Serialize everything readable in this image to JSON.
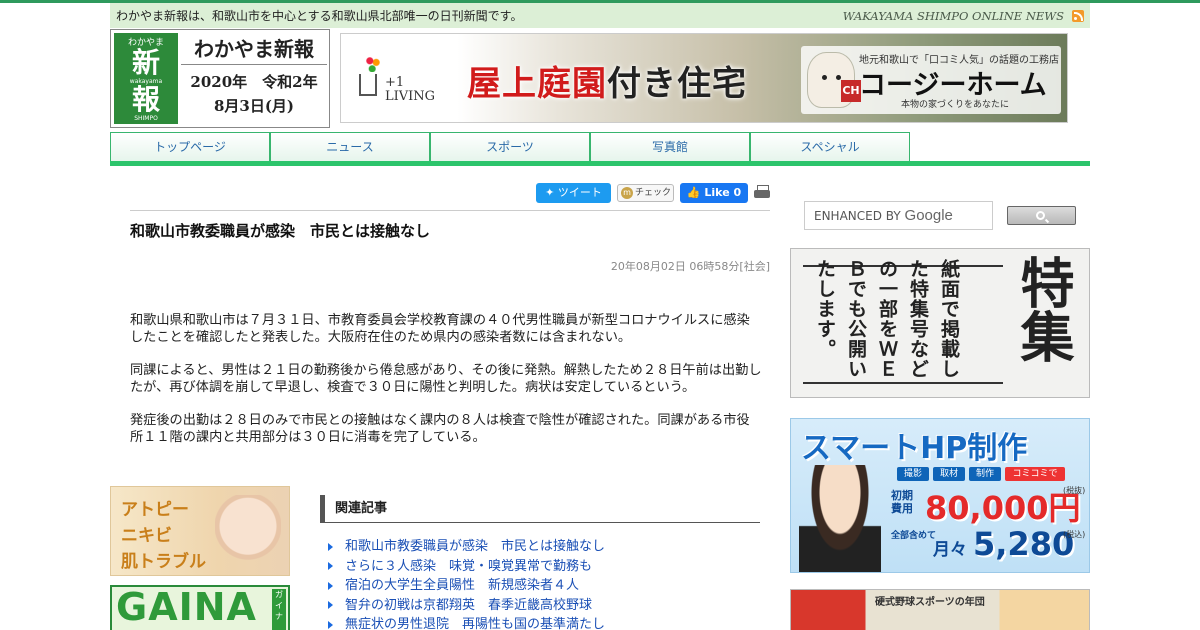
{
  "site": {
    "tagline": "わかやま新報は、和歌山市を中心とする和歌山県北部唯一の日刊新聞です。",
    "brand_en": "WAKAYAMA SHIMPO ONLINE NEWS",
    "logo_small": "わかやま",
    "logo_small_en": "wakayama",
    "logo_big_1": "新",
    "logo_big_2": "報",
    "logo_en": "SHIMPO",
    "logo_title": "わかやま新報",
    "date_line1": "2020年　令和2年",
    "date_line2": "8月3日(月)"
  },
  "banner": {
    "living": "+1\nLIVING",
    "headline_red": "屋上庭園",
    "headline_dark": "付き住宅",
    "company_sub": "地元和歌山で「口コミ人気」の話題の工務店",
    "company": "コージーホーム",
    "company_foot": "本物の家づくりをあなたに",
    "company_mark": "CH"
  },
  "nav": {
    "items": [
      "トップページ",
      "ニュース",
      "スポーツ",
      "写真館",
      "スペシャル"
    ]
  },
  "share": {
    "tweet": "ツイート",
    "check": "チェック",
    "mixi_mark": "m",
    "like": "Like 0"
  },
  "article": {
    "title": "和歌山市教委職員が感染　市民とは接触なし",
    "meta": "20年08月02日 06時58分[社会]",
    "paragraphs": [
      "和歌山県和歌山市は７月３１日、市教育委員会学校教育課の４０代男性職員が新型コロナウイルスに感染したことを確認したと発表した。大阪府在住のため県内の感染者数には含まれない。",
      "同課によると、男性は２１日の勤務後から倦怠感があり、その後に発熱。解熱したため２８日午前は出勤したが、再び体調を崩して早退し、検査で３０日に陽性と判明した。病状は安定しているという。",
      "発症後の出勤は２８日のみで市民との接触はなく課内の８人は検査で陰性が確認された。同課がある市役所１１階の課内と共用部分は３０日に消毒を完了している。"
    ]
  },
  "related": {
    "heading": "関連記事",
    "items": [
      "和歌山市教委職員が感染　市民とは接触なし",
      "さらに３人感染　味覚・嗅覚異常で勤務も",
      "宿泊の大学生全員陽性　新規感染者４人",
      "智弁の初戦は京都翔英　春季近畿高校野球",
      "無症状の男性退院　再陽性も国の基準満たし"
    ]
  },
  "left_ads": {
    "atopy": [
      "アトピー",
      "ニキビ",
      "肌トラブル"
    ],
    "gaina": "GAINA",
    "gaina_side": "ガイナ"
  },
  "search": {
    "placeholder": "ENHANCED BY",
    "google": "Google"
  },
  "tokushu": {
    "big": "特集",
    "text": "紙面で掲載した特集号などの一部をＷＥＢでも公開いたします。"
  },
  "smart_ad": {
    "title": "スマートHP制作",
    "tags": [
      "撮影",
      "取材",
      "制作",
      "コミコミで"
    ],
    "initial": "初期\n費用",
    "price1": "80,000円",
    "tax1": "(税抜)",
    "monthly": "全部含めて",
    "monthly_b": "月々",
    "price2": "5,280円",
    "tax2": "(税込)"
  },
  "book_ad": {
    "title": "硬式野球スポーツの年団"
  }
}
